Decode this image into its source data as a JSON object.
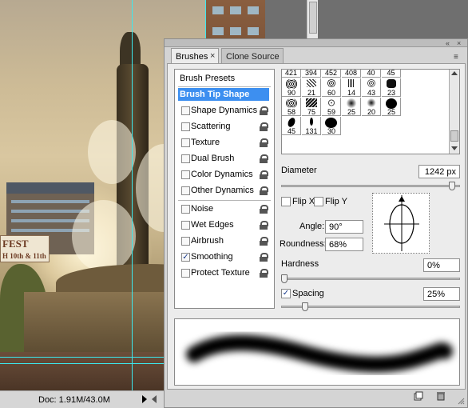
{
  "document": {
    "banner_title": "FEST",
    "banner_sub": "H 10th & 11th",
    "doc_info": "Doc: 1.91M/43.0M"
  },
  "panel": {
    "tabs": [
      {
        "label": "Brushes",
        "active": true
      },
      {
        "label": "Clone Source",
        "active": false
      }
    ],
    "settings": [
      {
        "label": "Brush Presets",
        "type": "header"
      },
      {
        "label": "Brush Tip Shape",
        "type": "selected"
      },
      {
        "label": "Shape Dynamics",
        "checked": false
      },
      {
        "label": "Scattering",
        "checked": false
      },
      {
        "label": "Texture",
        "checked": false
      },
      {
        "label": "Dual Brush",
        "checked": false
      },
      {
        "label": "Color Dynamics",
        "checked": false
      },
      {
        "label": "Other Dynamics",
        "checked": false
      },
      {
        "label": "Noise",
        "checked": false
      },
      {
        "label": "Wet Edges",
        "checked": false
      },
      {
        "label": "Airbrush",
        "checked": false
      },
      {
        "label": "Smoothing",
        "checked": true
      },
      {
        "label": "Protect Texture",
        "checked": false
      }
    ],
    "brush_top_numbers": [
      "421",
      "394",
      "452",
      "408",
      "40",
      "45"
    ],
    "brush_rows": [
      [
        "90",
        "21",
        "60",
        "14",
        "43",
        "23"
      ],
      [
        "58",
        "75",
        "59",
        "25",
        "20",
        "25"
      ],
      [
        "45",
        "131",
        "30"
      ]
    ],
    "diameter": {
      "label": "Diameter",
      "value": "1242 px"
    },
    "flip_x": {
      "label": "Flip X",
      "checked": false
    },
    "flip_y": {
      "label": "Flip Y",
      "checked": false
    },
    "angle": {
      "label": "Angle:",
      "value": "90°"
    },
    "roundness": {
      "label": "Roundness:",
      "value": "68%"
    },
    "hardness": {
      "label": "Hardness",
      "value": "0%"
    },
    "spacing": {
      "label": "Spacing",
      "value": "25%",
      "checked": true
    },
    "sliders": {
      "diameter": 0.97,
      "hardness": 0.0,
      "spacing": 0.12
    }
  },
  "icons": {
    "close_tab": "×",
    "panel_menu": "≡",
    "collapse": "«",
    "panel_close": "×"
  }
}
